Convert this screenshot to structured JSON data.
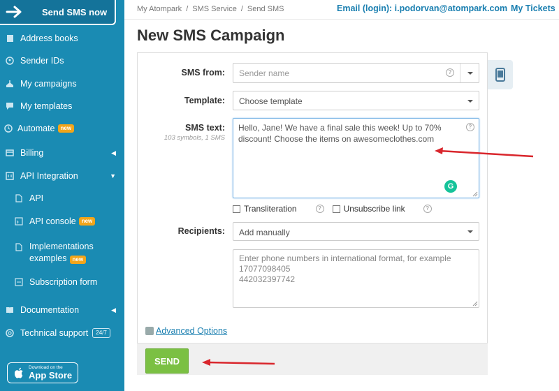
{
  "sidebar": {
    "send_now": "Send SMS now",
    "items": [
      {
        "label": "Address books",
        "icon": "book-icon"
      },
      {
        "label": "Sender IDs",
        "icon": "id-icon"
      },
      {
        "label": "My campaigns",
        "icon": "campaign-icon"
      },
      {
        "label": "My templates",
        "icon": "template-icon"
      },
      {
        "label": "Automate",
        "icon": "clock-icon",
        "badge": "new"
      },
      {
        "label": "Billing",
        "icon": "billing-icon"
      },
      {
        "label": "API Integration",
        "icon": "api-icon"
      },
      {
        "label": "API",
        "icon": "doc-icon"
      },
      {
        "label": "API console",
        "icon": "console-icon",
        "badge": "new"
      },
      {
        "label": "Implementations",
        "label2": "examples",
        "icon": "doc-icon",
        "badge": "new"
      },
      {
        "label": "Subscription form",
        "icon": "form-icon"
      },
      {
        "label": "Documentation",
        "icon": "book-icon"
      },
      {
        "label": "Technical support",
        "icon": "support-icon",
        "badge": "24/7"
      }
    ],
    "appstore": {
      "small": "Download on the",
      "big": "App Store"
    }
  },
  "topbar": {
    "breadcrumbs": [
      "My Atompark",
      "/",
      "SMS Service",
      "/",
      "Send SMS"
    ],
    "email": "Email (login): i.podorvan@atompark.com",
    "tickets": "My Tickets"
  },
  "page": {
    "title": "New SMS Campaign"
  },
  "form": {
    "sms_from_label": "SMS from:",
    "sms_from_placeholder": "Sender name",
    "template_label": "Template:",
    "template_value": "Choose template",
    "sms_text_label": "SMS text:",
    "sms_text_hint": "103 symbols, 1 SMS",
    "sms_text_value": "Hello, Jane! We have a final sale this week! Up to 70% discount! Choose the items on awesomeclothes.com",
    "transliteration_label": "Transliteration",
    "unsubscribe_label": "Unsubscribe link",
    "recipients_label": "Recipients:",
    "recipients_value": "Add manually",
    "recipients_placeholder_lines": [
      "Enter phone numbers in international format, for example",
      "17077098405",
      "442032397742"
    ],
    "advanced_options": "Advanced Options",
    "send_button": "SEND"
  },
  "colors": {
    "sidebar": "#1a8bb3",
    "accent": "#1a7fb0",
    "send": "#7bc043",
    "badge": "#f2a51a",
    "arrow": "#d9262c"
  }
}
